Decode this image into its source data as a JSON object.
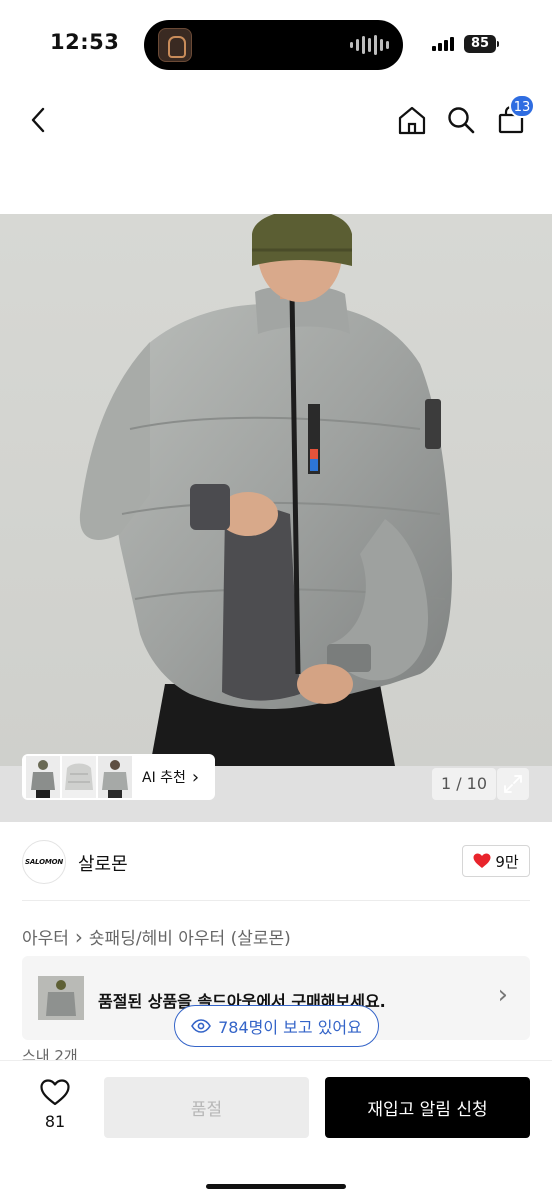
{
  "status_bar": {
    "time": "12:53",
    "battery": "85",
    "signal_icon": "signal-bars-icon",
    "island_icon": "now-playing-waveform-icon"
  },
  "header": {
    "back_icon": "chevron-left-icon",
    "home_icon": "home-icon",
    "search_icon": "search-icon",
    "cart_icon": "shopping-bag-icon",
    "cart_count": "13"
  },
  "gallery": {
    "counter": "1 / 10",
    "expand_icon": "expand-arrows-icon",
    "ai_label": "AI 추천",
    "ai_chevron": "›",
    "thumbnails": 3
  },
  "brand": {
    "logo_text": "SALOMON",
    "name": "살로몬",
    "like_count": "9만",
    "like_icon": "heart-filled-icon",
    "like_color": "#e8242c"
  },
  "breadcrumb": {
    "category": "아우터",
    "separator": "›",
    "subcategory": "숏패딩/헤비 아우터 (살로몬)"
  },
  "soldout_banner": {
    "text": "품절된 상품을 솔드아웃에서 구매해보세요.",
    "chevron": "›"
  },
  "viewers": {
    "text": "784명이 보고 있어요",
    "icon": "eye-icon",
    "color": "#3464c8"
  },
  "peek": {
    "text": "스내 2개"
  },
  "bottom_bar": {
    "wish_count": "81",
    "wish_icon": "heart-outline-icon",
    "soldout_label": "품절",
    "restock_label": "재입고 알림 신청"
  }
}
